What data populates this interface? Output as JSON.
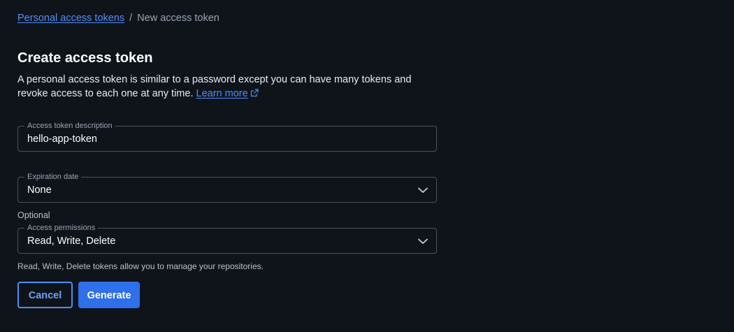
{
  "breadcrumb": {
    "parent": "Personal access tokens",
    "separator": "/",
    "current": "New access token"
  },
  "page": {
    "title": "Create access token",
    "description": "A personal access token is similar to a password except you can have many tokens and revoke access to each one at any time.",
    "learn_more": "Learn more",
    "learn_more_icon": "external-link-icon"
  },
  "form": {
    "token_description": {
      "label": "Access token description",
      "value": "hello-app-token"
    },
    "expiration": {
      "label": "Expiration date",
      "value": "None",
      "icon": "chevron-down-icon"
    },
    "optional_label": "Optional",
    "permissions": {
      "label": "Access permissions",
      "value": "Read, Write, Delete",
      "icon": "chevron-down-icon",
      "helper": "Read, Write, Delete tokens allow you to manage your repositories."
    }
  },
  "actions": {
    "cancel": "Cancel",
    "generate": "Generate"
  },
  "colors": {
    "background": "#0f141b",
    "accent": "#2f6fea",
    "link": "#4f8ff7"
  }
}
